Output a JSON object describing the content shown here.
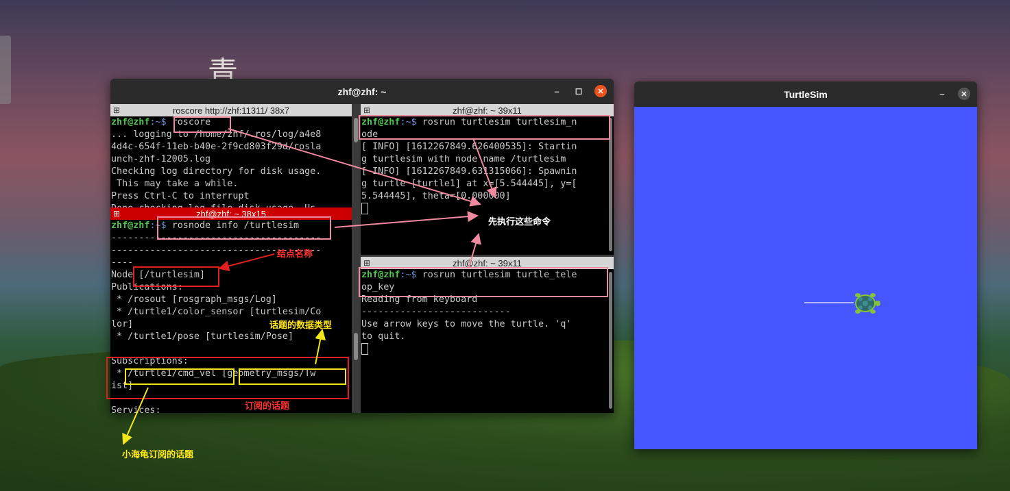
{
  "desktop": {
    "decor_char": "青"
  },
  "terminal": {
    "title": "zhf@zhf: ~",
    "pane_roscore": {
      "header": "roscore http://zhf:11311/ 38x7",
      "lines": [
        "... logging to /home/zhf/.ros/log/a4e8",
        "4d4c-654f-11eb-b40e-2f9cd803f29d/rosla",
        "unch-zhf-12005.log",
        "Checking log directory for disk usage.",
        " This may take a while.",
        "Press Ctrl-C to interrupt",
        "Done checking log file disk usage. Us"
      ],
      "prompt_user": "zhf@zhf",
      "prompt_path": ":~$ ",
      "command": "roscore"
    },
    "pane_info": {
      "header": "zhf@zhf: ~ 38x15",
      "prompt_user": "zhf@zhf",
      "prompt_path": ":~$ ",
      "command": "rosnode info /turtlesim",
      "lines": [
        "--------------------------------------",
        "--------------------------------------",
        "----",
        "Node [/turtlesim]",
        "Publications:",
        " * /rosout [rosgraph_msgs/Log]",
        " * /turtle1/color_sensor [turtlesim/Co",
        "lor]",
        " * /turtle1/pose [turtlesim/Pose]",
        "",
        "Subscriptions:",
        " * /turtle1/cmd_vel [geometry_msgs/Tw",
        "ist]",
        "",
        "Services:"
      ]
    },
    "pane_node": {
      "header": "zhf@zhf: ~ 39x11",
      "prompt_user": "zhf@zhf",
      "prompt_path": ":~$ ",
      "command": "rosrun turtlesim turtlesim_n",
      "command2": "ode",
      "lines": [
        "[ INFO] [1612267849.626400535]: Startin",
        "g turtlesim with node name /turtlesim",
        "[ INFO] [1612267849.631315066]: Spawnin",
        "g turtle [turtle1] at x=[5.544445], y=[",
        "5.544445], theta=[0.000000]"
      ]
    },
    "pane_teleop": {
      "header": "zhf@zhf: ~ 39x11",
      "prompt_user": "zhf@zhf",
      "prompt_path": ":~$ ",
      "command": "rosrun turtlesim turtle_tele",
      "command2": "op_key",
      "lines": [
        "Reading from keyboard",
        "---------------------------",
        "Use arrow keys to move the turtle. 'q'",
        "to quit."
      ]
    }
  },
  "turtlesim": {
    "title": "TurtleSim",
    "bg_color": "#4556ff",
    "turtle_icon": "turtle-icon"
  },
  "annotations": {
    "run_first": "先执行这些命令",
    "node_name": "结点名称",
    "topic_type": "话题的数据类型",
    "subscribed_topic": "订阅的话题",
    "turtle_subscribed": "小海龟订阅的话题"
  },
  "colors": {
    "accent_close": "#e95420",
    "active_pane": "#cc0000",
    "prompt_green": "#4ec44e",
    "annot_pink": "#f08aa0",
    "annot_red": "#e02020",
    "annot_yellow": "#f2e61b"
  }
}
